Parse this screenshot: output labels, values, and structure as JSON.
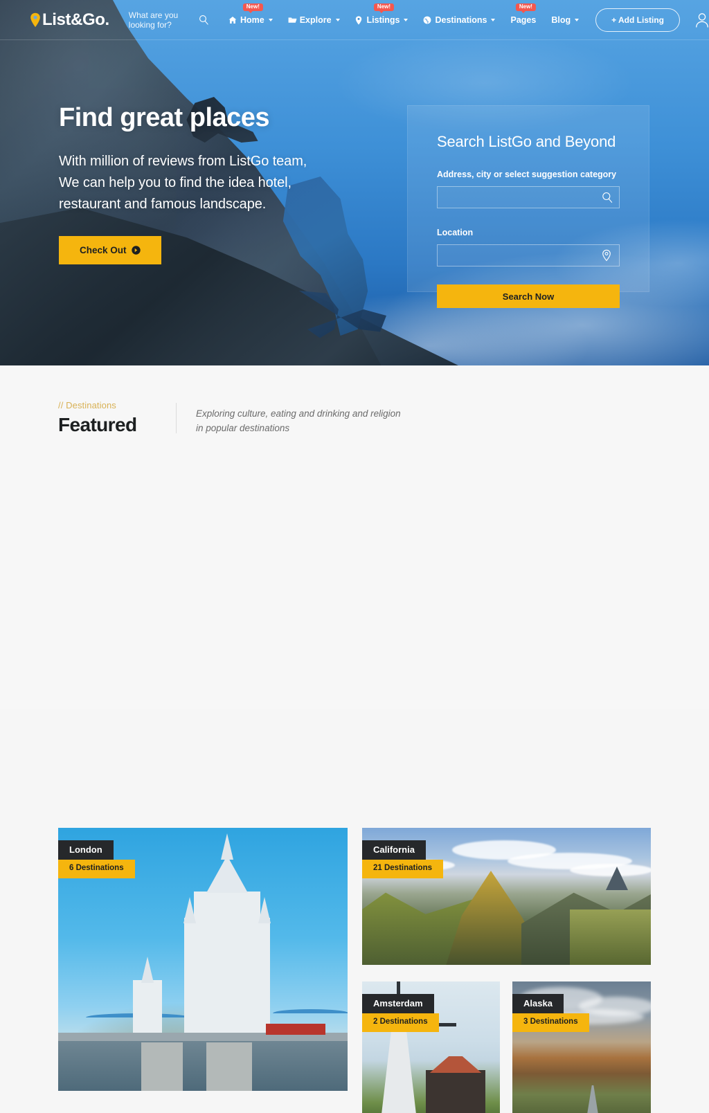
{
  "brand": {
    "name": "List&Go.",
    "pin_icon": "location-pin-icon",
    "accent": "#f5b50e",
    "badge_color": "#f4574e"
  },
  "navbar": {
    "search_placeholder": "What are you looking for?",
    "search_icon": "search-icon",
    "user_icon": "user-account-icon",
    "add_listing_label": "+ Add Listing",
    "items": [
      {
        "label": "Home",
        "icon": "home-icon",
        "caret": true,
        "badge": "New!"
      },
      {
        "label": "Explore",
        "icon": "folder-open-icon",
        "caret": true,
        "badge": null
      },
      {
        "label": "Listings",
        "icon": "map-pin-icon",
        "caret": true,
        "badge": "New!"
      },
      {
        "label": "Destinations",
        "icon": "globe-icon",
        "caret": true,
        "badge": null
      },
      {
        "label": "Pages",
        "icon": null,
        "caret": false,
        "badge": "New!"
      },
      {
        "label": "Blog",
        "icon": null,
        "caret": true,
        "badge": null
      }
    ]
  },
  "hero": {
    "title": "Find great places",
    "subtitle": "With million of reviews from ListGo team,\nWe can help you to find the idea hotel,\nrestaurant and famous landscape.",
    "subtitle_lines": [
      "With million of reviews from ListGo team,",
      "We can help you to find the idea hotel,",
      "restaurant and famous landscape."
    ],
    "cta_label": "Check Out",
    "cta_icon": "arrow-circle-right-icon"
  },
  "search_panel": {
    "title": "Search ListGo and Beyond",
    "fields": [
      {
        "label": "Address, city or select suggestion category",
        "value": "",
        "placeholder": "",
        "icon": "search-icon"
      },
      {
        "label": "Location",
        "value": "",
        "placeholder": "",
        "icon": "map-pin-icon"
      }
    ],
    "submit_label": "Search Now"
  },
  "featured": {
    "eyebrow": "// Destinations",
    "title": "Featured",
    "description": "Exploring culture, eating and drinking and religion in popular destinations",
    "cards": [
      {
        "name": "London",
        "count": "6 Destinations"
      },
      {
        "name": "California",
        "count": "21 Destinations"
      },
      {
        "name": "Amsterdam",
        "count": "2 Destinations"
      },
      {
        "name": "Alaska",
        "count": "3 Destinations"
      }
    ]
  }
}
